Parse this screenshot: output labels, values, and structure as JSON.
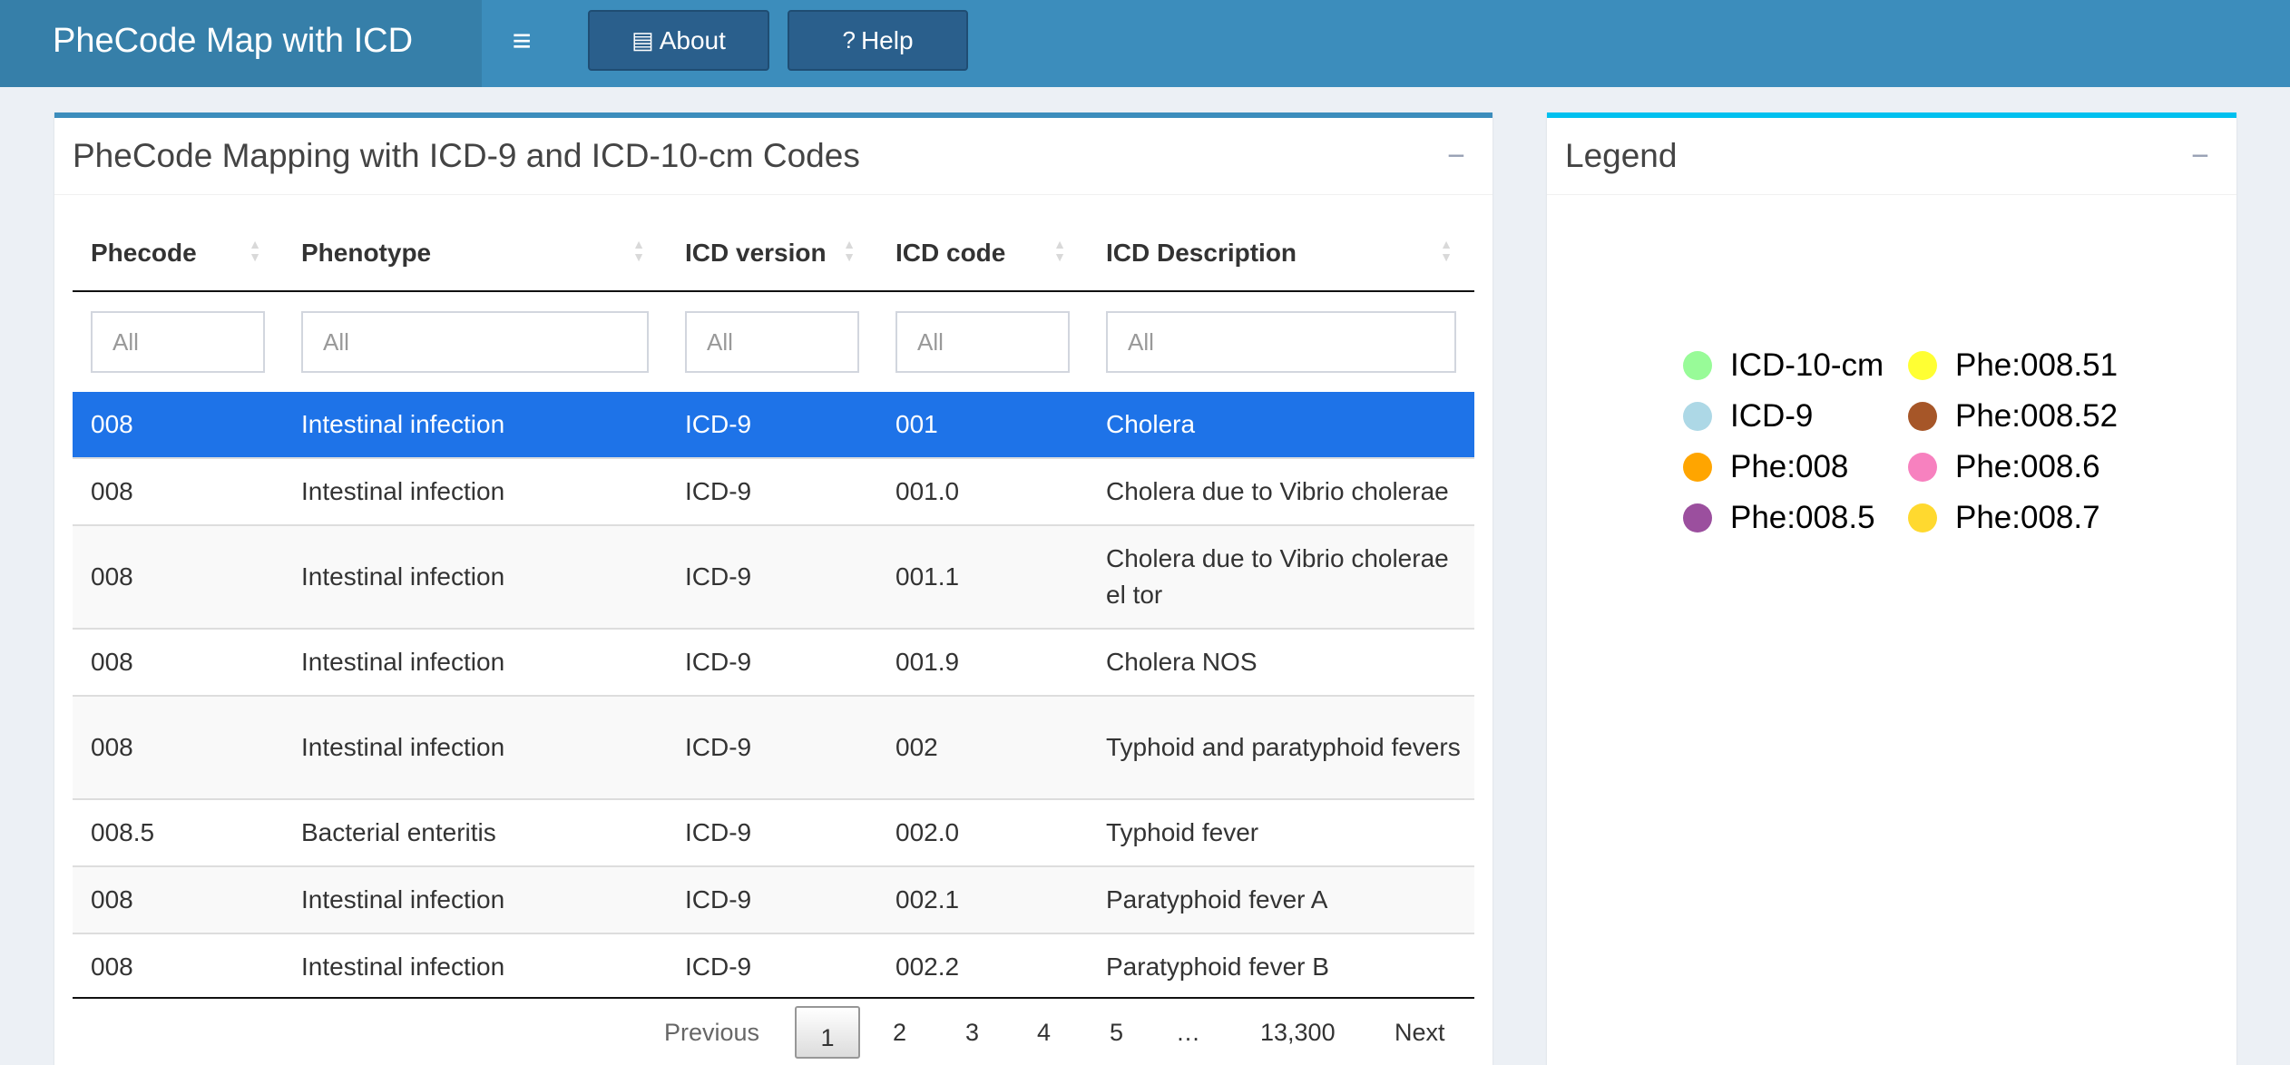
{
  "header": {
    "title": "PheCode Map with ICD",
    "menu_icon": "hamburger-icon",
    "about_label": "About",
    "help_label": "Help"
  },
  "main_box": {
    "title": "PheCode Mapping with ICD-9 and ICD-10-cm Codes",
    "collapse": "−",
    "columns": [
      "Phecode",
      "Phenotype",
      "ICD version",
      "ICD code",
      "ICD Description"
    ],
    "filter_placeholder": "All",
    "rows": [
      {
        "phecode": "008",
        "phenotype": "Intestinal infection",
        "icd_version": "ICD-9",
        "icd_code": "001",
        "description": "Cholera"
      },
      {
        "phecode": "008",
        "phenotype": "Intestinal infection",
        "icd_version": "ICD-9",
        "icd_code": "001.0",
        "description": "Cholera due to Vibrio cholerae"
      },
      {
        "phecode": "008",
        "phenotype": "Intestinal infection",
        "icd_version": "ICD-9",
        "icd_code": "001.1",
        "description": "Cholera due to Vibrio cholerae el tor"
      },
      {
        "phecode": "008",
        "phenotype": "Intestinal infection",
        "icd_version": "ICD-9",
        "icd_code": "001.9",
        "description": "Cholera NOS"
      },
      {
        "phecode": "008",
        "phenotype": "Intestinal infection",
        "icd_version": "ICD-9",
        "icd_code": "002",
        "description": "Typhoid and paratyphoid fevers"
      },
      {
        "phecode": "008.5",
        "phenotype": "Bacterial enteritis",
        "icd_version": "ICD-9",
        "icd_code": "002.0",
        "description": "Typhoid fever"
      },
      {
        "phecode": "008",
        "phenotype": "Intestinal infection",
        "icd_version": "ICD-9",
        "icd_code": "002.1",
        "description": "Paratyphoid fever A"
      },
      {
        "phecode": "008",
        "phenotype": "Intestinal infection",
        "icd_version": "ICD-9",
        "icd_code": "002.2",
        "description": "Paratyphoid fever B"
      }
    ],
    "selected_row": 0,
    "pagination": {
      "previous": "Previous",
      "pages": [
        "1",
        "2",
        "3",
        "4",
        "5",
        "…",
        "13,300"
      ],
      "current": "1",
      "next": "Next"
    }
  },
  "legend_box": {
    "title": "Legend",
    "collapse": "−",
    "items": [
      {
        "label": "ICD-10-cm",
        "color": "#98fb98"
      },
      {
        "label": "ICD-9",
        "color": "#add8e6"
      },
      {
        "label": "Phe:008",
        "color": "#ffa500"
      },
      {
        "label": "Phe:008.5",
        "color": "#9b4f9e"
      },
      {
        "label": "Phe:008.51",
        "color": "#ffff33"
      },
      {
        "label": "Phe:008.52",
        "color": "#a65628"
      },
      {
        "label": "Phe:008.6",
        "color": "#f781bf"
      },
      {
        "label": "Phe:008.7",
        "color": "#ffd92f"
      }
    ]
  },
  "colors": {
    "header_bg": "#3c8dbc",
    "logo_bg": "#367fa9",
    "selected_row": "#1e73e8",
    "legend_accent": "#00c0ef"
  }
}
